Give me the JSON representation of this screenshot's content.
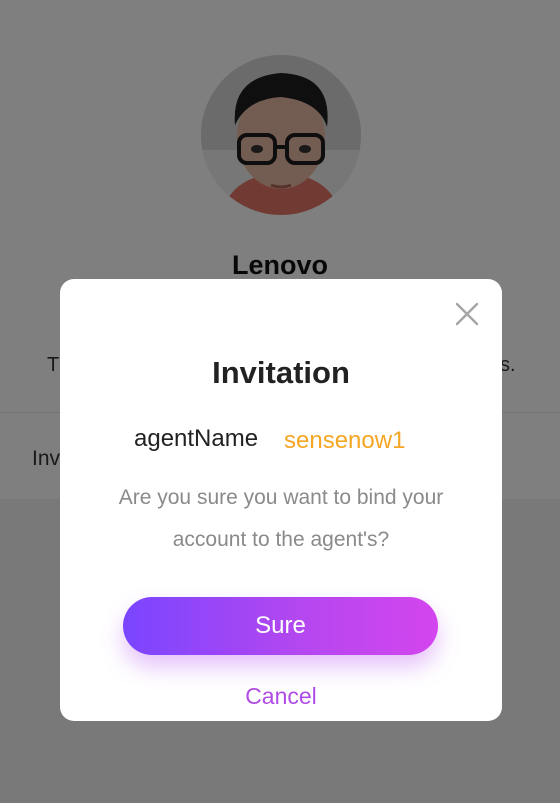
{
  "profile": {
    "name": "Lenovo"
  },
  "background": {
    "left_text": "T",
    "right_text": "s.",
    "invite_row_text": "Inv"
  },
  "dialog": {
    "title": "Invitation",
    "agent_label": "agentName",
    "agent_value": "sensenow1",
    "confirm_text": "Are you sure you want to bind your account to the agent's?",
    "sure_label": "Sure",
    "cancel_label": "Cancel",
    "close_icon": "close-icon"
  },
  "colors": {
    "accent_orange": "#f5a623",
    "button_gradient_start": "#7a45ff",
    "button_gradient_end": "#d445ee",
    "cancel_purple": "#b04ce6"
  }
}
